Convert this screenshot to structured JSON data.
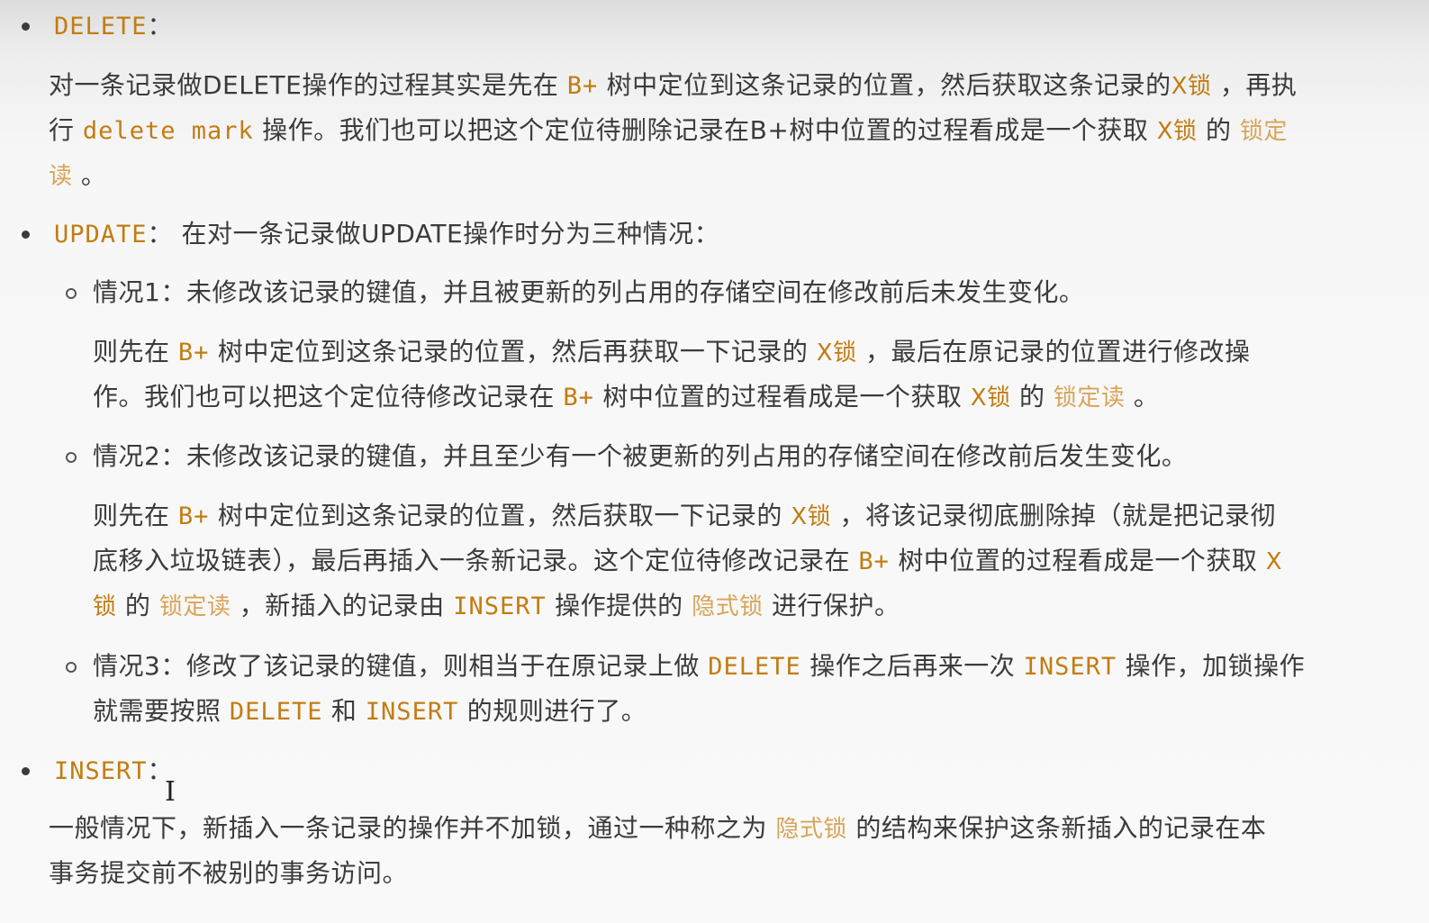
{
  "delete_section": {
    "keyword": "DELETE",
    "colon": "：",
    "p1_a": "对一条记录做DELETE操作的过程其实是先在",
    "p1_b": "B+",
    "p1_c": "树中定位到这条记录的位置，然后获取这条记录的",
    "p1_d": "X锁",
    "p1_e": "，再执",
    "p2_a": "行",
    "p2_b": "delete mark",
    "p2_c": "操作。我们也可以把这个定位待删除记录在B+树中位置的过程看成是一个获取",
    "p2_d": "X锁",
    "p2_e": "的",
    "p2_f": "锁定",
    "p3_a": "读",
    "p3_b": "。"
  },
  "update_section": {
    "keyword": "UPDATE",
    "intro": "：  在对一条记录做UPDATE操作时分为三种情况：",
    "case1": {
      "title": "情况1：未修改该记录的键值，并且被更新的列占用的存储空间在修改前后未发生变化。",
      "l1_a": "则先在",
      "l1_b": "B+",
      "l1_c": "树中定位到这条记录的位置，然后再获取一下记录的",
      "l1_d": "X锁",
      "l1_e": "，最后在原记录的位置进行修改操",
      "l2_a": "作。我们也可以把这个定位待修改记录在",
      "l2_b": "B+",
      "l2_c": "树中位置的过程看成是一个获取",
      "l2_d": "X锁",
      "l2_e": "的",
      "l2_f": "锁定读",
      "l2_g": "。"
    },
    "case2": {
      "title": "情况2：未修改该记录的键值，并且至少有一个被更新的列占用的存储空间在修改前后发生变化。",
      "l1_a": "则先在",
      "l1_b": "B+",
      "l1_c": "树中定位到这条记录的位置，然后获取一下记录的",
      "l1_d": "X锁",
      "l1_e": "，将该记录彻底删除掉（就是把记录彻",
      "l2_a": "底移入垃圾链表），最后再插入一条新记录。这个定位待修改记录在",
      "l2_b": "B+",
      "l2_c": "树中位置的过程看成是一个获取",
      "l2_d": "X",
      "l3_a": "锁",
      "l3_b": "的",
      "l3_c": "锁定读",
      "l3_d": "，新插入的记录由",
      "l3_e": "INSERT",
      "l3_f": "操作提供的",
      "l3_g": "隐式锁",
      "l3_h": "进行保护。"
    },
    "case3": {
      "l1_a": "情况3：修改了该记录的键值，则相当于在原记录上做",
      "l1_b": "DELETE",
      "l1_c": "操作之后再来一次",
      "l1_d": "INSERT",
      "l1_e": "操作，加锁操作",
      "l2_a": "就需要按照",
      "l2_b": "DELETE",
      "l2_c": "和",
      "l2_d": "INSERT",
      "l2_e": "的规则进行了。"
    }
  },
  "insert_section": {
    "keyword": "INSERT",
    "colon": "：",
    "l1_a": "一般情况下，新插入一条记录的操作并不加锁，通过一种称之为",
    "l1_b": "隐式锁",
    "l1_c": "的结构来保护这条新插入的记录在本",
    "l2_a": "事务提交前不被别的事务访问。"
  },
  "cursor_glyph": "I",
  "colors": {
    "code": "#c27c12",
    "term": "#d8a458",
    "text": "#3b3b3b"
  }
}
